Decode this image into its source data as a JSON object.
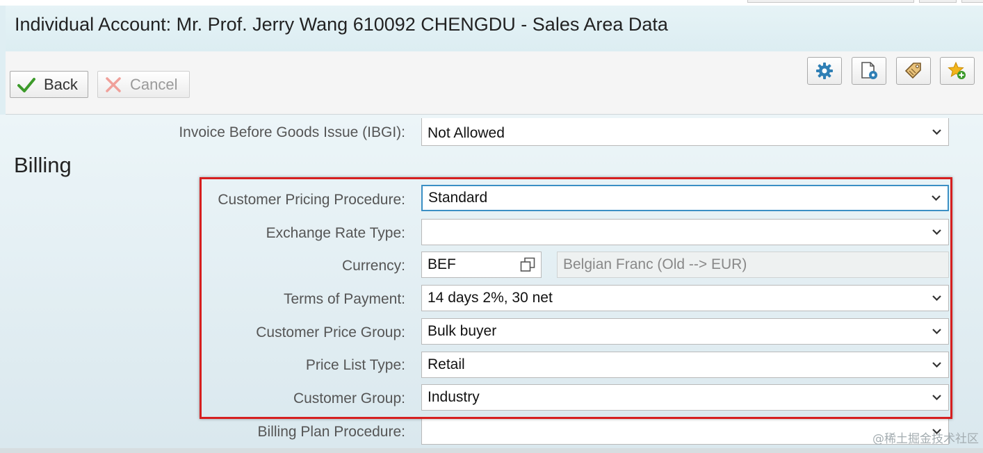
{
  "header": {
    "title": "Individual Account: Mr. Prof. Jerry Wang 610092 CHENGDU - Sales Area Data"
  },
  "toolbar": {
    "back_label": "Back",
    "cancel_label": "Cancel",
    "icons": [
      "gear-icon",
      "document-settings-icon",
      "tag-icon",
      "add-favorite-icon"
    ]
  },
  "form": {
    "ibgi": {
      "label": "Invoice Before Goods Issue (IBGI):",
      "value": "Not Allowed"
    },
    "section_title": "Billing",
    "pricing_procedure": {
      "label": "Customer Pricing Procedure:",
      "value": "Standard"
    },
    "exchange_rate_type": {
      "label": "Exchange Rate Type:",
      "value": ""
    },
    "currency": {
      "label": "Currency:",
      "value": "BEF",
      "description": "Belgian Franc (Old --> EUR)"
    },
    "terms_of_payment": {
      "label": "Terms of Payment:",
      "value": "14 days 2%, 30 net"
    },
    "price_group": {
      "label": "Customer Price Group:",
      "value": "Bulk buyer"
    },
    "price_list_type": {
      "label": "Price List Type:",
      "value": "Retail"
    },
    "customer_group": {
      "label": "Customer Group:",
      "value": "Industry"
    },
    "billing_plan_procedure": {
      "label": "Billing Plan Procedure:",
      "value": ""
    }
  },
  "watermark": "@稀土掘金技术社区",
  "colors": {
    "highlight": "#d61f1f",
    "focus": "#3b8fc4",
    "check": "#3c9a2a"
  }
}
